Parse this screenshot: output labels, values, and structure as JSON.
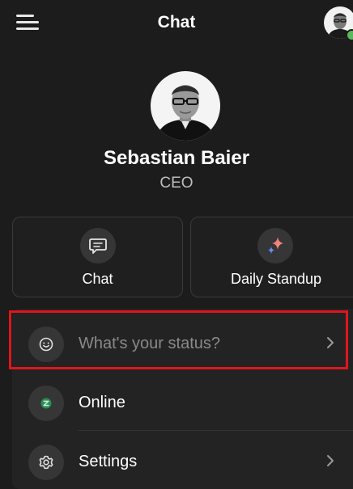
{
  "header": {
    "title": "Chat",
    "menu_icon": "hamburger-menu-icon",
    "avatar": "user-avatar"
  },
  "profile": {
    "name": "Sebastian Baier",
    "role": "CEO",
    "presence": "online"
  },
  "quick_actions": [
    {
      "label": "Chat",
      "icon": "chat-bubble-icon"
    },
    {
      "label": "Daily Standup",
      "icon": "sparkles-icon"
    }
  ],
  "menu": {
    "status": {
      "placeholder": "What's your status?",
      "icon": "smiley-icon"
    },
    "online": {
      "label": "Online",
      "icon": "online-presence-icon"
    },
    "settings": {
      "label": "Settings",
      "icon": "gear-icon"
    }
  },
  "colors": {
    "background": "#1c1c1c",
    "card_border": "#3a3a3a",
    "icon_circle": "#363636",
    "online_green": "#5cb85c",
    "highlight_red": "#e0161d",
    "sparkle_pink": "#f0609a",
    "sparkle_blue": "#6a8cf7"
  }
}
